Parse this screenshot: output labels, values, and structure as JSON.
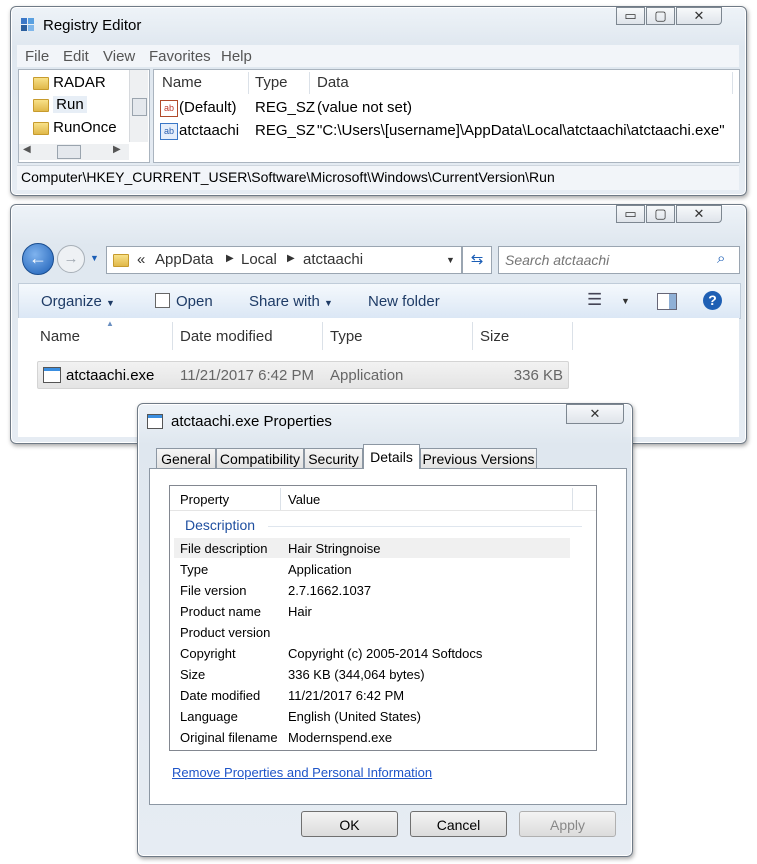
{
  "registry": {
    "title": "Registry Editor",
    "menu": [
      "File",
      "Edit",
      "View",
      "Favorites",
      "Help"
    ],
    "tree": [
      "RADAR",
      "Run",
      "RunOnce"
    ],
    "columns": [
      "Name",
      "Type",
      "Data"
    ],
    "rows": [
      {
        "name": "(Default)",
        "type": "REG_SZ",
        "data": "(value not set)"
      },
      {
        "name": "atctaachi",
        "type": "REG_SZ",
        "data": "\"C:\\Users\\[username]\\AppData\\Local\\atctaachi\\atctaachi.exe\""
      }
    ],
    "status": "Computer\\HKEY_CURRENT_USER\\Software\\Microsoft\\Windows\\CurrentVersion\\Run"
  },
  "explorer": {
    "breadcrumb": [
      "AppData",
      "Local",
      "atctaachi"
    ],
    "breadcrumb_prefix": "«",
    "search_placeholder": "Search atctaachi",
    "toolbar": {
      "organize": "Organize",
      "open": "Open",
      "share": "Share with",
      "new_folder": "New folder"
    },
    "columns": [
      "Name",
      "Date modified",
      "Type",
      "Size"
    ],
    "file": {
      "name": "atctaachi.exe",
      "date": "11/21/2017 6:42 PM",
      "type": "Application",
      "size": "336 KB"
    }
  },
  "props": {
    "title": "atctaachi.exe Properties",
    "tabs": [
      "General",
      "Compatibility",
      "Security",
      "Details",
      "Previous Versions"
    ],
    "active_tab": "Details",
    "columns": [
      "Property",
      "Value"
    ],
    "section": "Description",
    "rows": [
      {
        "property": "File description",
        "value": "Hair Stringnoise"
      },
      {
        "property": "Type",
        "value": "Application"
      },
      {
        "property": "File version",
        "value": "2.7.1662.1037"
      },
      {
        "property": "Product name",
        "value": "Hair"
      },
      {
        "property": "Product version",
        "value": ""
      },
      {
        "property": "Copyright",
        "value": "Copyright (c) 2005-2014 Softdocs"
      },
      {
        "property": "Size",
        "value": "336 KB (344,064 bytes)"
      },
      {
        "property": "Date modified",
        "value": "11/21/2017 6:42 PM"
      },
      {
        "property": "Language",
        "value": "English (United States)"
      },
      {
        "property": "Original filename",
        "value": "Modernspend.exe"
      }
    ],
    "remove_link": "Remove Properties and Personal Information",
    "buttons": {
      "ok": "OK",
      "cancel": "Cancel",
      "apply": "Apply"
    }
  },
  "window_buttons": {
    "minimize": "▭",
    "maximize": "▢",
    "close": "✕"
  }
}
